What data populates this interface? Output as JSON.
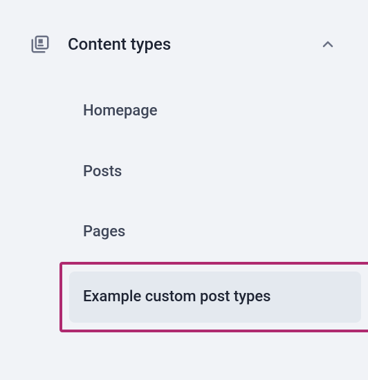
{
  "menu": {
    "title": "Content types",
    "items": [
      {
        "label": "Homepage"
      },
      {
        "label": "Posts"
      },
      {
        "label": "Pages"
      },
      {
        "label": "Example custom post types"
      }
    ]
  }
}
